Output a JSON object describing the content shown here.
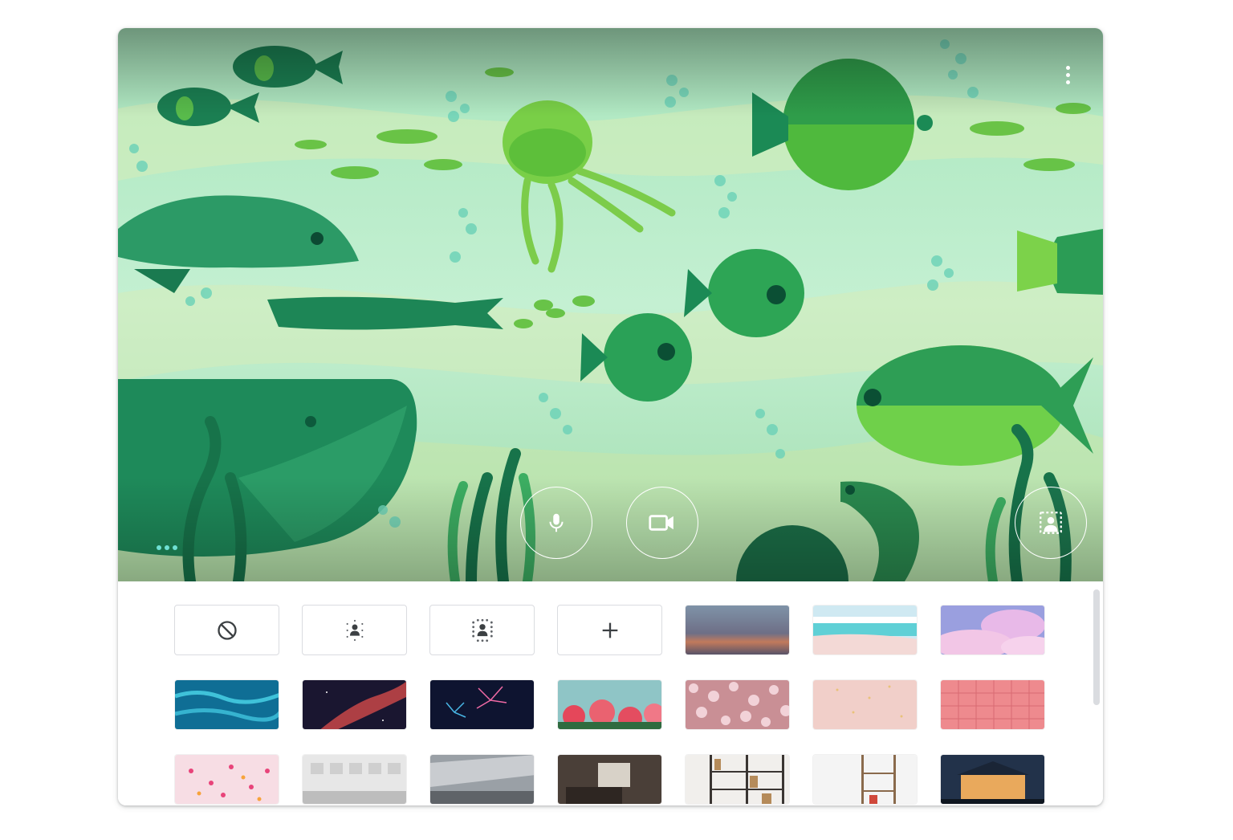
{
  "preview": {
    "background_name": "underwater-fish-illustration",
    "colors": {
      "water": "#bfeecd",
      "fish_dark": "#1a8a56",
      "fish_light": "#6ed34a",
      "deep": "#0e6b4c"
    }
  },
  "controls": {
    "more_options_label": "More options",
    "mic_label": "Turn off microphone",
    "camera_label": "Turn off camera",
    "effects_label": "Apply visual effects"
  },
  "gallery": {
    "options": [
      {
        "name": "no-effect",
        "icon": "block-icon",
        "label": "Turn off background effects"
      },
      {
        "name": "slight-blur",
        "icon": "slight-blur-icon",
        "label": "Slightly blur your background"
      },
      {
        "name": "blur",
        "icon": "blur-icon",
        "label": "Blur your background"
      },
      {
        "name": "upload",
        "icon": "plus-icon",
        "label": "Upload a background image"
      }
    ],
    "images": [
      {
        "name": "dusk-gradient",
        "label": "Dusk sky"
      },
      {
        "name": "beach",
        "label": "Beach"
      },
      {
        "name": "pink-clouds",
        "label": "Pink clouds"
      },
      {
        "name": "pool-water",
        "label": "Pool water"
      },
      {
        "name": "nebula",
        "label": "Nebula"
      },
      {
        "name": "fireworks",
        "label": "Fireworks"
      },
      {
        "name": "flowers",
        "label": "Flowers"
      },
      {
        "name": "blossoms",
        "label": "Cherry blossoms"
      },
      {
        "name": "pink-glitter",
        "label": "Pink sparkles"
      },
      {
        "name": "pink-pattern",
        "label": "Pink pattern"
      },
      {
        "name": "confetti",
        "label": "Confetti"
      },
      {
        "name": "gallery-room",
        "label": "Gallery room"
      },
      {
        "name": "office-space",
        "label": "Office space"
      },
      {
        "name": "living-room",
        "label": "Living room"
      },
      {
        "name": "bookshelf",
        "label": "Bookshelf"
      },
      {
        "name": "white-shelves",
        "label": "White shelves"
      },
      {
        "name": "night-house",
        "label": "House at night"
      }
    ],
    "accent": "#1a73e8",
    "border": "#dadce0"
  }
}
